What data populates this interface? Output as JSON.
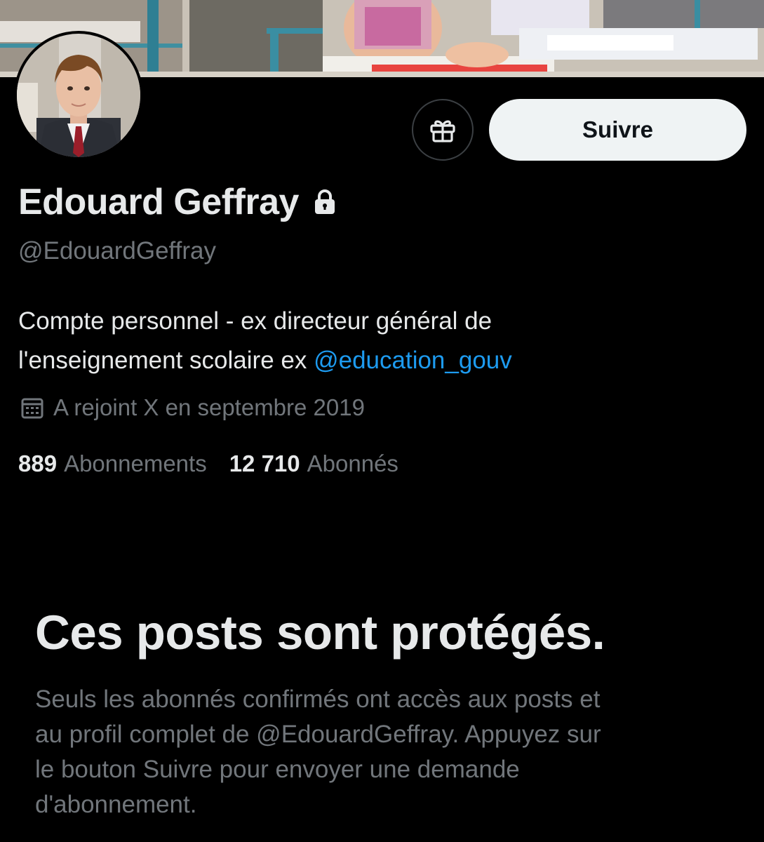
{
  "profile": {
    "display_name": "Edouard Geffray",
    "handle": "@EdouardGeffray",
    "bio_line1": "Compte personnel - ex directeur général de",
    "bio_line2_text": "l'enseignement scolaire ex ",
    "bio_mention": "@education_gouv",
    "joined": "A rejoint X en septembre 2019",
    "following_count": "889",
    "following_label": "Abonnements",
    "followers_count": "12 710",
    "followers_label": "Abonnés"
  },
  "actions": {
    "follow_label": "Suivre"
  },
  "protected": {
    "title": "Ces posts sont protégés.",
    "desc_line1": "Seuls les abonnés confirmés ont accès aux posts et",
    "desc_line2": "au profil complet de @EdouardGeffray. Appuyez sur",
    "desc_line3": "le bouton Suivre pour envoyer une demande",
    "desc_line4": "d'abonnement."
  },
  "icons": {
    "gift": "gift-icon",
    "lock": "lock-icon",
    "calendar": "calendar-icon"
  },
  "colors": {
    "background": "#000000",
    "text_primary": "#e7e9ea",
    "text_secondary": "#71767b",
    "link": "#1d9bf0",
    "follow_button_bg": "#eff3f4",
    "follow_button_text": "#0f1419",
    "button_border": "#3b3f43"
  }
}
